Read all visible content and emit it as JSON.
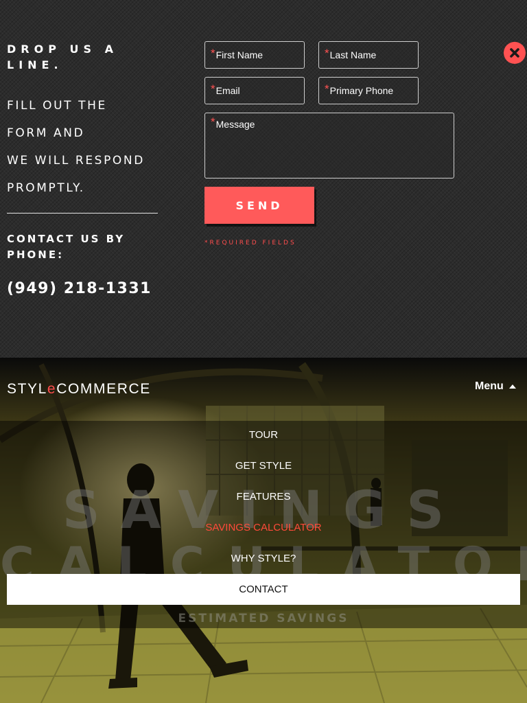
{
  "contact": {
    "title": "DROP US A LINE.",
    "body_lines": [
      "FILL OUT THE",
      "FORM AND",
      "WE WILL RESPOND",
      "PROMPTLY."
    ],
    "phone_title": "CONTACT US BY PHONE:",
    "phone_number": "(949) 218-1331",
    "close_icon": "close-icon"
  },
  "form": {
    "required_mark": "*",
    "first_name_placeholder": "First Name",
    "last_name_placeholder": "Last Name",
    "email_placeholder": "Email",
    "phone_placeholder": "Primary Phone",
    "message_placeholder": "Message",
    "send_label": "SEND",
    "required_note": "*REQUIRED FIELDS"
  },
  "header": {
    "logo_prefix": "STYL",
    "logo_accent": "e",
    "logo_suffix": "COMMERCE",
    "menu_label": "Menu"
  },
  "nav": {
    "items": [
      "TOUR",
      "GET STYLE",
      "FEATURES",
      "SAVINGS CALCULATOR",
      "WHY STYLE?",
      "CONTACT"
    ],
    "active": "SAVINGS CALCULATOR"
  },
  "hero": {
    "heading_line1": "SAVINGS",
    "heading_line2": "CALCULATOR",
    "subheading": "ESTIMATED SAVINGS"
  },
  "colors": {
    "accent": "#ff5a5a",
    "panel_bg": "#2c2c2c",
    "active_link": "#ff4a3a"
  }
}
